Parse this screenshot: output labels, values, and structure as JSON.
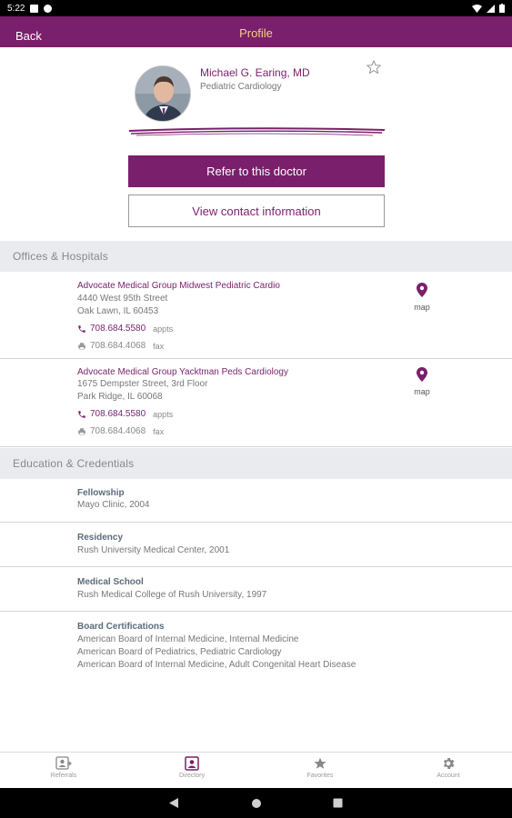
{
  "status_bar": {
    "time": "5:22"
  },
  "app_bar": {
    "back_label": "Back",
    "title": "Profile"
  },
  "doctor": {
    "name": "Michael G. Earing, MD",
    "specialty": "Pediatric Cardiology"
  },
  "actions": {
    "refer_label": "Refer to this doctor",
    "contact_label": "View contact information"
  },
  "offices_section": {
    "title": "Offices & Hospitals",
    "offices": [
      {
        "name": "Advocate Medical Group Midwest Pediatric Cardio",
        "address1": "4440 West 95th Street",
        "address2": "Oak Lawn, IL 60453",
        "phone": "708.684.5580",
        "phone_label": "appts",
        "fax": "708.684.4068",
        "fax_label": "fax",
        "map_label": "map"
      },
      {
        "name": "Advocate Medical Group Yacktman Peds Cardiology",
        "address1": "1675 Dempster Street, 3rd Floor",
        "address2": "Park Ridge, IL 60068",
        "phone": "708.684.5580",
        "phone_label": "appts",
        "fax": "708.684.4068",
        "fax_label": "fax",
        "map_label": "map"
      }
    ]
  },
  "education_section": {
    "title": "Education & Credentials",
    "items": [
      {
        "title": "Fellowship",
        "lines": [
          "Mayo Clinic, 2004"
        ]
      },
      {
        "title": "Residency",
        "lines": [
          "Rush University Medical Center, 2001"
        ]
      },
      {
        "title": "Medical School",
        "lines": [
          "Rush Medical College of Rush University, 1997"
        ]
      },
      {
        "title": "Board Certifications",
        "lines": [
          "American Board of Internal Medicine, Internal Medicine",
          "American Board of Pediatrics, Pediatric Cardiology",
          "American Board of Internal Medicine, Adult Congenital Heart Disease"
        ]
      }
    ]
  },
  "bottom_nav": {
    "items": [
      {
        "label": "Referrals",
        "icon": "referrals-icon"
      },
      {
        "label": "Directory",
        "icon": "directory-icon"
      },
      {
        "label": "Favorites",
        "icon": "star-icon"
      },
      {
        "label": "Account",
        "icon": "gear-icon"
      }
    ]
  },
  "colors": {
    "brand": "#7a1f6b",
    "title_accent": "#f3d08a",
    "section_bg": "#e9ebee"
  }
}
